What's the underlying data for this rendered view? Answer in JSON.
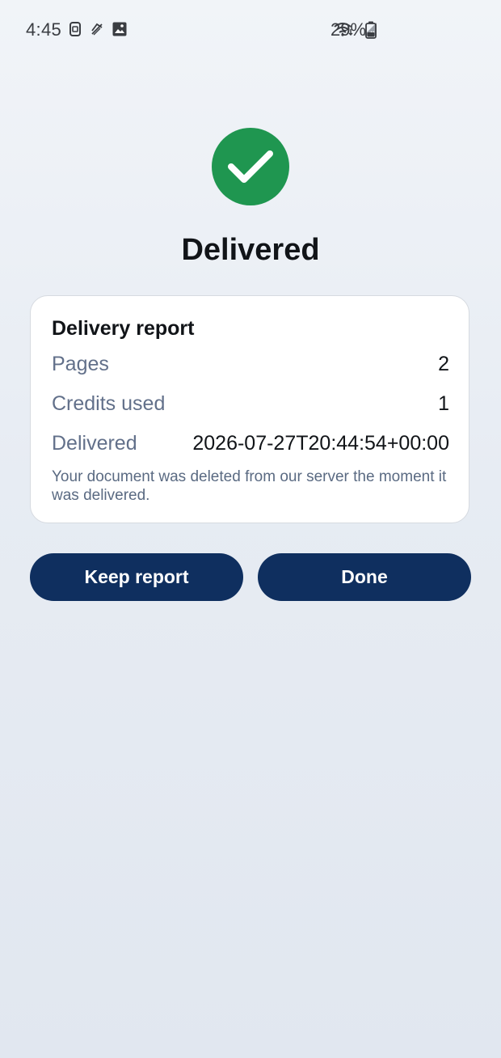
{
  "status_bar": {
    "time": "4:45",
    "battery_percent": "29%",
    "icons_left": [
      "sim-card-icon",
      "sync-off-icon",
      "image-icon"
    ],
    "icons_right": [
      "wifi-icon",
      "signal-icon",
      "battery-icon"
    ]
  },
  "header": {
    "title": "Delivered",
    "success_color": "#1f9650"
  },
  "report": {
    "title": "Delivery report",
    "rows": [
      {
        "label": "Pages",
        "value": "2"
      },
      {
        "label": "Credits used",
        "value": "1"
      },
      {
        "label": "Delivered",
        "value": "2026-07-27T20:44:54+00:00"
      }
    ],
    "note": "Your document was deleted from our server the moment it was delivered."
  },
  "actions": {
    "keep_label": "Keep report",
    "done_label": "Done",
    "button_color": "#0f2f5f"
  }
}
